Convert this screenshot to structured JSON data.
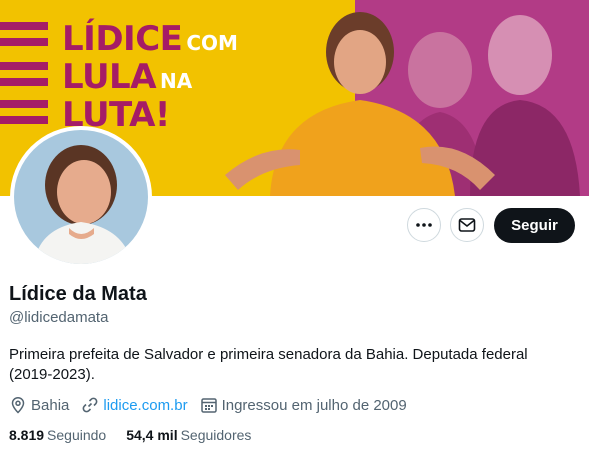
{
  "banner": {
    "line1": "LÍDICE",
    "line1_small": "COM",
    "line2": "LULA",
    "line2_small": "NA",
    "line3": "LUTA!"
  },
  "actions": {
    "more_icon": "more-icon",
    "message_icon": "envelope-icon",
    "follow_label": "Seguir"
  },
  "profile": {
    "name": "Lídice da Mata",
    "handle": "@lidicedamata",
    "bio": "Primeira prefeita de Salvador e primeira senadora da Bahia. Deputada federal (2019-2023).",
    "location": "Bahia",
    "website": "lidice.com.br",
    "joined": "Ingressou em julho de 2009"
  },
  "stats": {
    "following_count": "8.819",
    "following_label": "Seguindo",
    "followers_count": "54,4 mil",
    "followers_label": "Seguidores"
  },
  "colors": {
    "banner_yellow": "#f2c200",
    "banner_magenta": "#a51c66",
    "banner_pink": "#b23b86",
    "link": "#1d9bf0",
    "secondary_text": "#536471",
    "follow_button": "#0f1419"
  }
}
